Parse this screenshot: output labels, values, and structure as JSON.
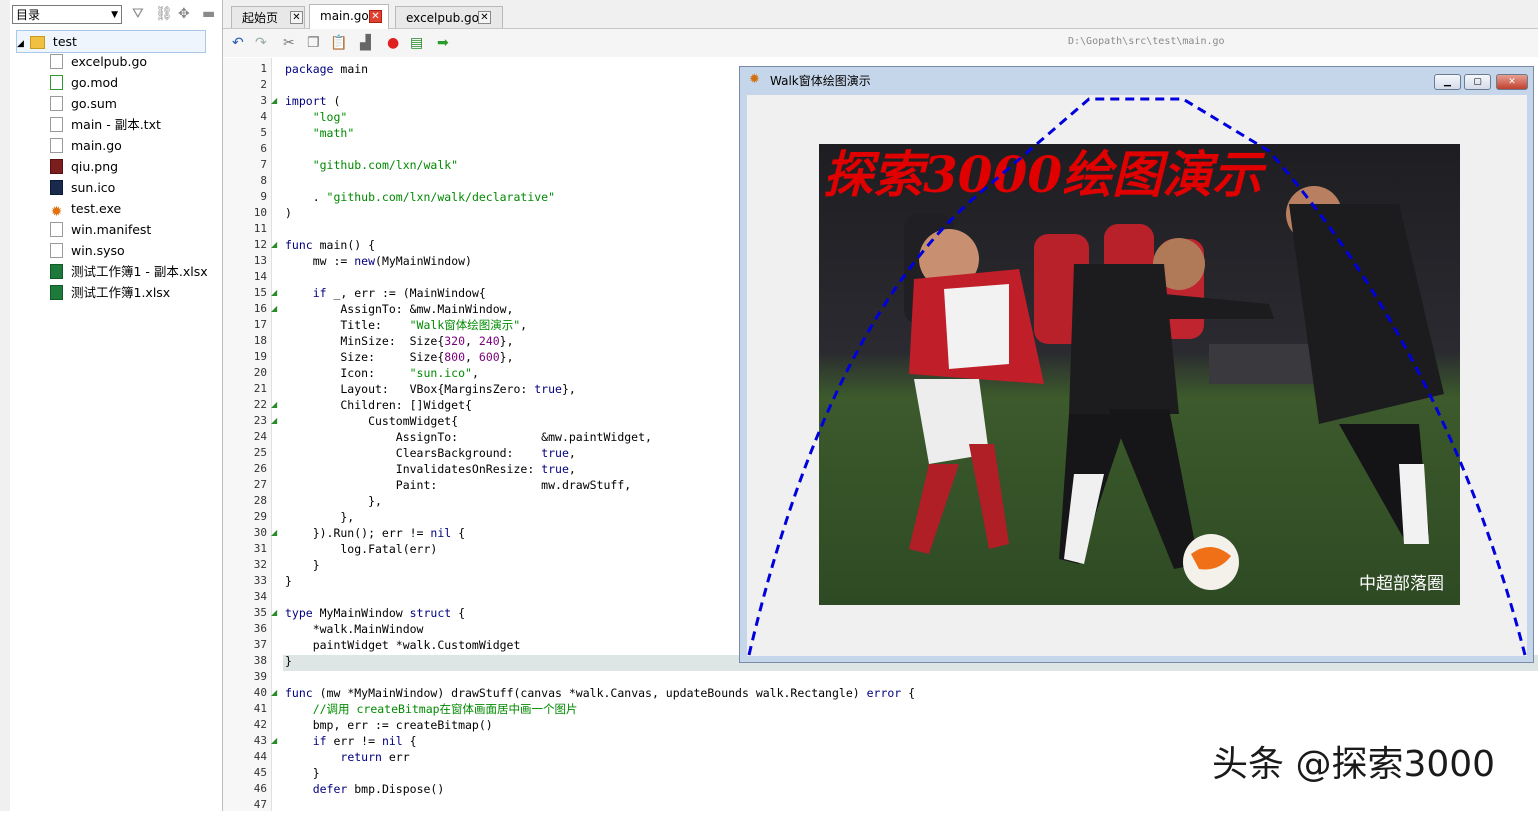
{
  "file_panel": {
    "combo_label": "目录",
    "toolbar_icons": [
      "filter-icon",
      "link-icon",
      "move-icon",
      "minimize-icon"
    ],
    "root": "test",
    "files": [
      {
        "name": "excelpub.go",
        "icon": "doc"
      },
      {
        "name": "go.mod",
        "icon": "gomod"
      },
      {
        "name": "go.sum",
        "icon": "doc"
      },
      {
        "name": "main - 副本.txt",
        "icon": "doc"
      },
      {
        "name": "main.go",
        "icon": "doc"
      },
      {
        "name": "qiu.png",
        "icon": "png"
      },
      {
        "name": "sun.ico",
        "icon": "ico"
      },
      {
        "name": "test.exe",
        "icon": "exe"
      },
      {
        "name": "win.manifest",
        "icon": "doc"
      },
      {
        "name": "win.syso",
        "icon": "doc"
      },
      {
        "name": "测试工作簿1 - 副本.xlsx",
        "icon": "xls"
      },
      {
        "name": "测试工作簿1.xlsx",
        "icon": "xls"
      }
    ]
  },
  "tabs": [
    {
      "label": "起始页",
      "active": false
    },
    {
      "label": "main.go",
      "active": true
    },
    {
      "label": "excelpub.go",
      "active": false
    }
  ],
  "editor": {
    "path": "D:\\Gopath\\src\\test\\main.go",
    "highlighted_line": 38,
    "lines": [
      "package main",
      "",
      "import (",
      "    \"log\"",
      "    \"math\"",
      "",
      "    \"github.com/lxn/walk\"",
      "",
      "    . \"github.com/lxn/walk/declarative\"",
      ")",
      "",
      "func main() {",
      "    mw := new(MyMainWindow)",
      "",
      "    if _, err := (MainWindow{",
      "        AssignTo: &mw.MainWindow,",
      "        Title:    \"Walk窗体绘图演示\",",
      "        MinSize:  Size{320, 240},",
      "        Size:     Size{800, 600},",
      "        Icon:     \"sun.ico\",",
      "        Layout:   VBox{MarginsZero: true},",
      "        Children: []Widget{",
      "            CustomWidget{",
      "                AssignTo:            &mw.paintWidget,",
      "                ClearsBackground:    true,",
      "                InvalidatesOnResize: true,",
      "                Paint:               mw.drawStuff,",
      "            },",
      "        },",
      "    }).Run(); err != nil {",
      "        log.Fatal(err)",
      "    }",
      "}",
      "",
      "type MyMainWindow struct {",
      "    *walk.MainWindow",
      "    paintWidget *walk.CustomWidget",
      "}",
      "",
      "func (mw *MyMainWindow) drawStuff(canvas *walk.Canvas, updateBounds walk.Rectangle) error {",
      "    //调用 createBitmap在窗体画面居中画一个图片",
      "    bmp, err := createBitmap()",
      "    if err != nil {",
      "        return err",
      "    }",
      "    defer bmp.Dispose()",
      ""
    ]
  },
  "walk_window": {
    "title": "Walk窗体绘图演示",
    "buttons": [
      "minimize",
      "maximize",
      "close"
    ],
    "overlay_text": "探索3000绘图演示",
    "photo_caption": "中超部落圈"
  },
  "watermark": "头条 @探索3000",
  "colors": {
    "keyword": "#000080",
    "string": "#008a00",
    "number": "#7a007a",
    "overlay_text": "#e00000",
    "curve": "#0000dd"
  }
}
